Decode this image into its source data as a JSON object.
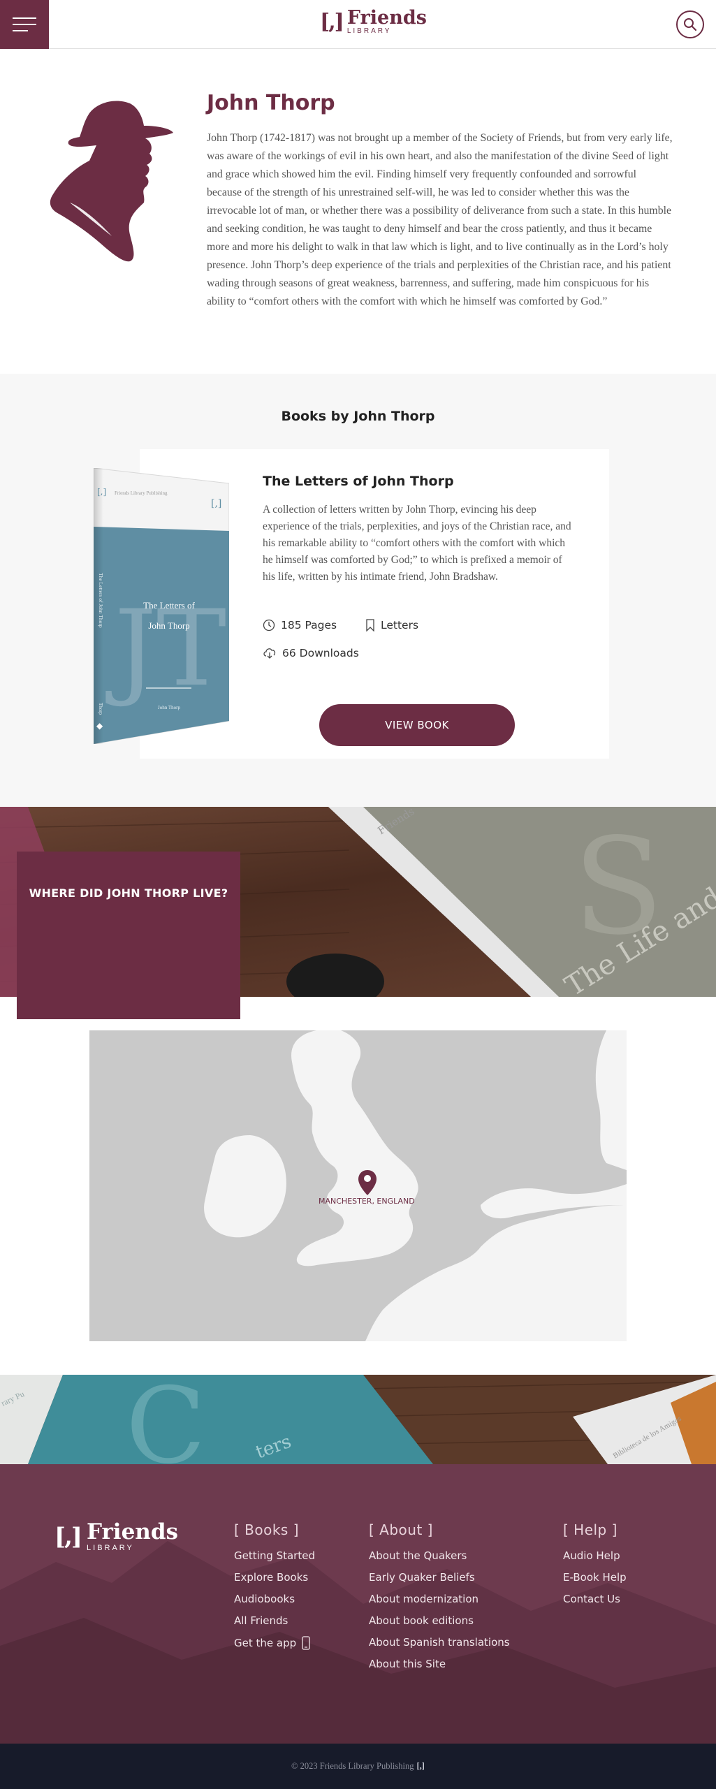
{
  "header": {
    "logo_bracket": "[,]",
    "logo_name": "Friends",
    "logo_sub": "LIBRARY"
  },
  "author": {
    "name": "John Thorp",
    "bio": "John Thorp (1742-1817) was not brought up a member of the Society of Friends, but from very early life, was aware of the workings of evil in his own heart, and also the manifestation of the divine Seed of light and grace which showed him the evil. Finding himself very frequently confounded and sorrowful because of the strength of his unrestrained self-will, he was led to consider whether this was the irrevocable lot of man, or whether there was a possibility of deliverance from such a state. In this humble and seeking condition, he was taught to deny himself and bear the cross patiently, and thus it became more and more his delight to walk in that law which is light, and to live continually as in the Lord’s holy presence. John Thorp’s deep experience of the trials and perplexities of the Christian race, and his patient wading through seasons of great weakness, barrenness, and suffering, made him conspicuous for his ability to “comfort others with the comfort with which he himself was comforted by God.”"
  },
  "books": {
    "heading": "Books by John Thorp",
    "items": [
      {
        "title": "The Letters of John Thorp",
        "description": "A collection of letters written by John Thorp, evincing his deep experience of the trials, perplexities, and joys of the Christian race, and his remarkable ability to “comfort others with the comfort with which he himself was comforted by God;” to which is prefixed a memoir of his life, written by his intimate friend, John Bradshaw.",
        "pages": "185 Pages",
        "tag": "Letters",
        "downloads": "66 Downloads",
        "button": "VIEW BOOK",
        "cover": {
          "publisher": "Friends Library Publishing",
          "spine_title": "The Letters of John Thorp",
          "title_line1": "The Letters of",
          "title_line2": "John Thorp",
          "author": "John Thorp",
          "monogram": "JT",
          "spine_author": "Thorp",
          "color": "#5f8ea3"
        }
      }
    ]
  },
  "where": {
    "heading": "WHERE DID JOHN THORP LIVE?"
  },
  "map": {
    "location": "MANCHESTER, ENGLAND"
  },
  "footer": {
    "logo_bracket": "[,]",
    "logo_name": "Friends",
    "logo_sub": "LIBRARY",
    "columns": [
      {
        "title": "[ Books ]",
        "links": [
          "Getting Started",
          "Explore Books",
          "Audiobooks",
          "All Friends",
          "Get the app"
        ]
      },
      {
        "title": "[ About ]",
        "links": [
          "About the Quakers",
          "Early Quaker Beliefs",
          "About modernization",
          "About book editions",
          "About Spanish translations",
          "About this Site"
        ]
      },
      {
        "title": "[ Help ]",
        "links": [
          "Audio Help",
          "E-Book Help",
          "Contact Us"
        ]
      }
    ],
    "copyright": "© 2023 Friends Library Publishing",
    "copyright_mark": "[,]"
  },
  "colors": {
    "brand": "#6c2d44",
    "footer_bg": "#6d3a4e",
    "copyright_bg": "#171b2a",
    "section_bg": "#f7f7f7",
    "map_land": "#ffffff",
    "map_sea": "#c9c9c9"
  }
}
